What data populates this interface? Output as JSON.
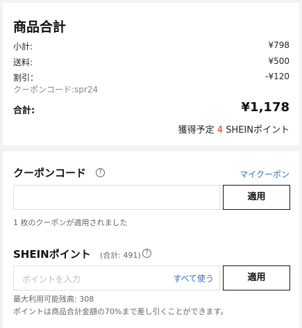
{
  "summary": {
    "title": "商品合計",
    "rows": [
      {
        "label": "小計:",
        "value": "¥798"
      },
      {
        "label": "送料:",
        "value": "¥500"
      },
      {
        "label": "割引：",
        "value": "-¥120"
      }
    ],
    "coupon_code": "クーポンコード:spr24",
    "total_label": "合計:",
    "total_value": "¥1,178",
    "points_prefix": "獲得予定",
    "points_num": "4",
    "points_suffix": "SHEINポイント"
  },
  "coupon": {
    "title": "クーポンコード",
    "my_coupon_link": "マイクーポン",
    "input_value": "",
    "apply_label": "適用",
    "applied_note": "1 枚のクーポンが適用されました"
  },
  "points": {
    "title": "SHEINポイント",
    "total_note": "(合計: 491)",
    "placeholder": "ポイントを入力",
    "use_all_label": "すべて使う",
    "apply_label": "適用",
    "max_note": "最大利用可能残高: 308",
    "limit_note": "ポイントは商品合計金額の70%まで差し引くことができます。"
  },
  "colors": {
    "accent_red": "#d9361a",
    "link_blue": "#2f6fb5"
  },
  "icons": {
    "help": "question-circle-icon"
  }
}
